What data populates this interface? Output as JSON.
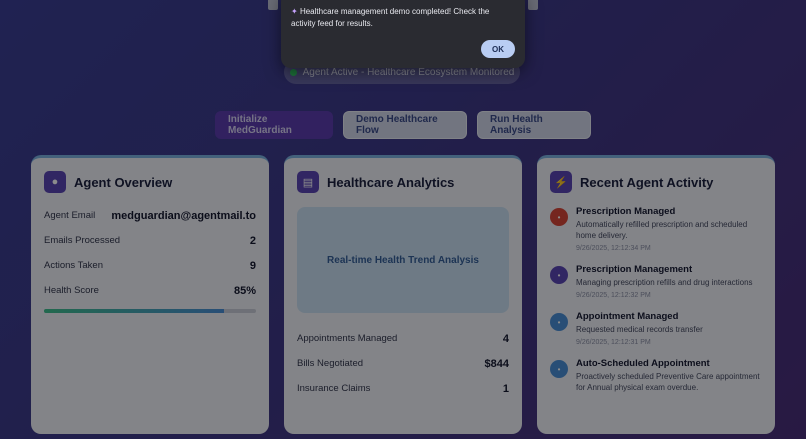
{
  "status": {
    "text": "Agent Active - Healthcare Ecosystem Monitored"
  },
  "buttons": {
    "initialize": "Initialize MedGuardian",
    "demo": "Demo Healthcare Flow",
    "analysis": "Run Health Analysis"
  },
  "overview": {
    "title": "Agent Overview",
    "icon": "robot-icon",
    "email_label": "Agent Email",
    "email_value": "medguardian@agentmail.to",
    "emails_label": "Emails Processed",
    "emails_value": "2",
    "actions_label": "Actions Taken",
    "actions_value": "9",
    "score_label": "Health Score",
    "score_value": "85%",
    "score_fraction": 0.85
  },
  "analytics": {
    "title": "Healthcare Analytics",
    "icon": "bar-chart-icon",
    "chart_label": "Real-time Health Trend Analysis",
    "appointments_label": "Appointments Managed",
    "appointments_value": "4",
    "bills_label": "Bills Negotiated",
    "bills_value": "$844",
    "claims_label": "Insurance Claims",
    "claims_value": "1"
  },
  "activity": {
    "title": "Recent Agent Activity",
    "icon": "lightning-icon",
    "items": [
      {
        "title": "Prescription Managed",
        "desc": "Automatically refilled prescription and scheduled home delivery.",
        "time": "9/26/2025, 12:12:34 PM",
        "color": "#d6453a",
        "icon": "pill-icon"
      },
      {
        "title": "Prescription Management",
        "desc": "Managing prescription refills and drug interactions",
        "time": "9/26/2025, 12:12:32 PM",
        "color": "#5a46b5",
        "icon": "pill-icon"
      },
      {
        "title": "Appointment Managed",
        "desc": "Requested medical records transfer",
        "time": "9/26/2025, 12:12:31 PM",
        "color": "#4a8fd8",
        "icon": "calendar-icon"
      },
      {
        "title": "Auto-Scheduled Appointment",
        "desc": "Proactively scheduled Preventive Care appointment for Annual physical exam overdue.",
        "time": "",
        "color": "#4a8fd8",
        "icon": "calendar-icon"
      }
    ]
  },
  "modal": {
    "message": "Healthcare management demo completed! Check the activity feed for results.",
    "ok_label": "OK"
  }
}
